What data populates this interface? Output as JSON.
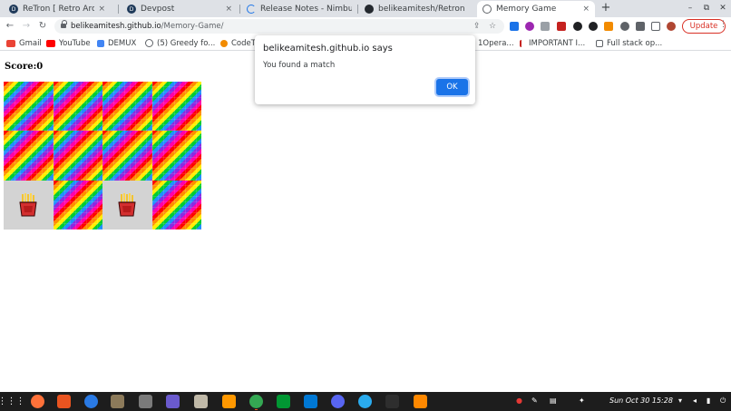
{
  "tabs": [
    {
      "label": "ReTron [ Retro Arcade X",
      "icon": "devpost-icon",
      "color": "#1f3a5a"
    },
    {
      "label": "Devpost",
      "icon": "devpost-icon",
      "color": "#1f3a5a"
    },
    {
      "label": "Release Notes - Nimbus",
      "icon": "loading-icon",
      "color": "#1a73e8"
    },
    {
      "label": "belikeamitesh/Retron",
      "icon": "github-icon",
      "color": "#24292f"
    },
    {
      "label": "Memory Game",
      "icon": "globe-icon",
      "color": "#5f6368",
      "active": true
    }
  ],
  "window_controls": {
    "minimize": "–",
    "restore": "⧉",
    "close": "✕",
    "tab_close": "×",
    "new_tab": "+"
  },
  "nav": {
    "back": "←",
    "forward": "→",
    "reload": "↻"
  },
  "address": {
    "host": "belikeamitesh.github.io",
    "path": "/Memory-Game/",
    "share": "⇪",
    "star": "☆"
  },
  "extensions": [
    "#1a73e8",
    "#9c27b0",
    "#9aa0a6",
    "#c5221f",
    "#202124",
    "#202124",
    "#f28b00",
    "#5f6368",
    "#5f6368",
    "#b04632"
  ],
  "update_label": "Update",
  "kebab": "⋮",
  "bookmarks": [
    {
      "label": "Gmail",
      "color": "#ea4335"
    },
    {
      "label": "YouTube",
      "color": "#ff0000"
    },
    {
      "label": "DEMUX",
      "color": "#4285f4"
    },
    {
      "label": "(5) Greedy fo...",
      "color": "#5f6368"
    },
    {
      "label": "CodeT",
      "color": "#f28b00"
    },
    {
      "label": "1Opera...",
      "color": "#ffffff"
    },
    {
      "label": "IMPORTANT I...",
      "color": "#c5221f"
    },
    {
      "label": "Full stack op...",
      "color": "#5f6368"
    }
  ],
  "score": {
    "label": "Score:0"
  },
  "dialog": {
    "title": "belikeamitesh.github.io says",
    "message": "You found a match",
    "ok": "OK"
  },
  "cards": [
    {
      "state": "down"
    },
    {
      "state": "down"
    },
    {
      "state": "down"
    },
    {
      "state": "down"
    },
    {
      "state": "down"
    },
    {
      "state": "down"
    },
    {
      "state": "down"
    },
    {
      "state": "down"
    },
    {
      "state": "up",
      "icon": "fries-icon"
    },
    {
      "state": "down"
    },
    {
      "state": "up",
      "icon": "fries-icon"
    },
    {
      "state": "down"
    }
  ],
  "taskbar": {
    "apps": [
      {
        "name": "app-grid-icon",
        "color": "#1d1d1d"
      },
      {
        "name": "firefox-icon",
        "color": "#ff7139"
      },
      {
        "name": "software-center-icon",
        "color": "#e95420"
      },
      {
        "name": "help-icon",
        "color": "#2a7ae4"
      },
      {
        "name": "gimp-icon",
        "color": "#8c7a5a"
      },
      {
        "name": "brasero-icon",
        "color": "#7a7a7a"
      },
      {
        "name": "screenshot-icon",
        "color": "#6a5acd"
      },
      {
        "name": "files-icon",
        "color": "#c0b9a8"
      },
      {
        "name": "sublime-icon",
        "color": "#ff9800"
      },
      {
        "name": "chrome-icon",
        "color": "#34a853"
      },
      {
        "name": "vim-icon",
        "color": "#019733"
      },
      {
        "name": "vscode-icon",
        "color": "#0078d4"
      },
      {
        "name": "discord-icon",
        "color": "#5865f2"
      },
      {
        "name": "telegram-icon",
        "color": "#2aabee"
      },
      {
        "name": "terminal-icon",
        "color": "#2e2e2e"
      },
      {
        "name": "vlc-icon",
        "color": "#ff8800"
      }
    ],
    "clock": "Sun Oct 30  15:28"
  }
}
